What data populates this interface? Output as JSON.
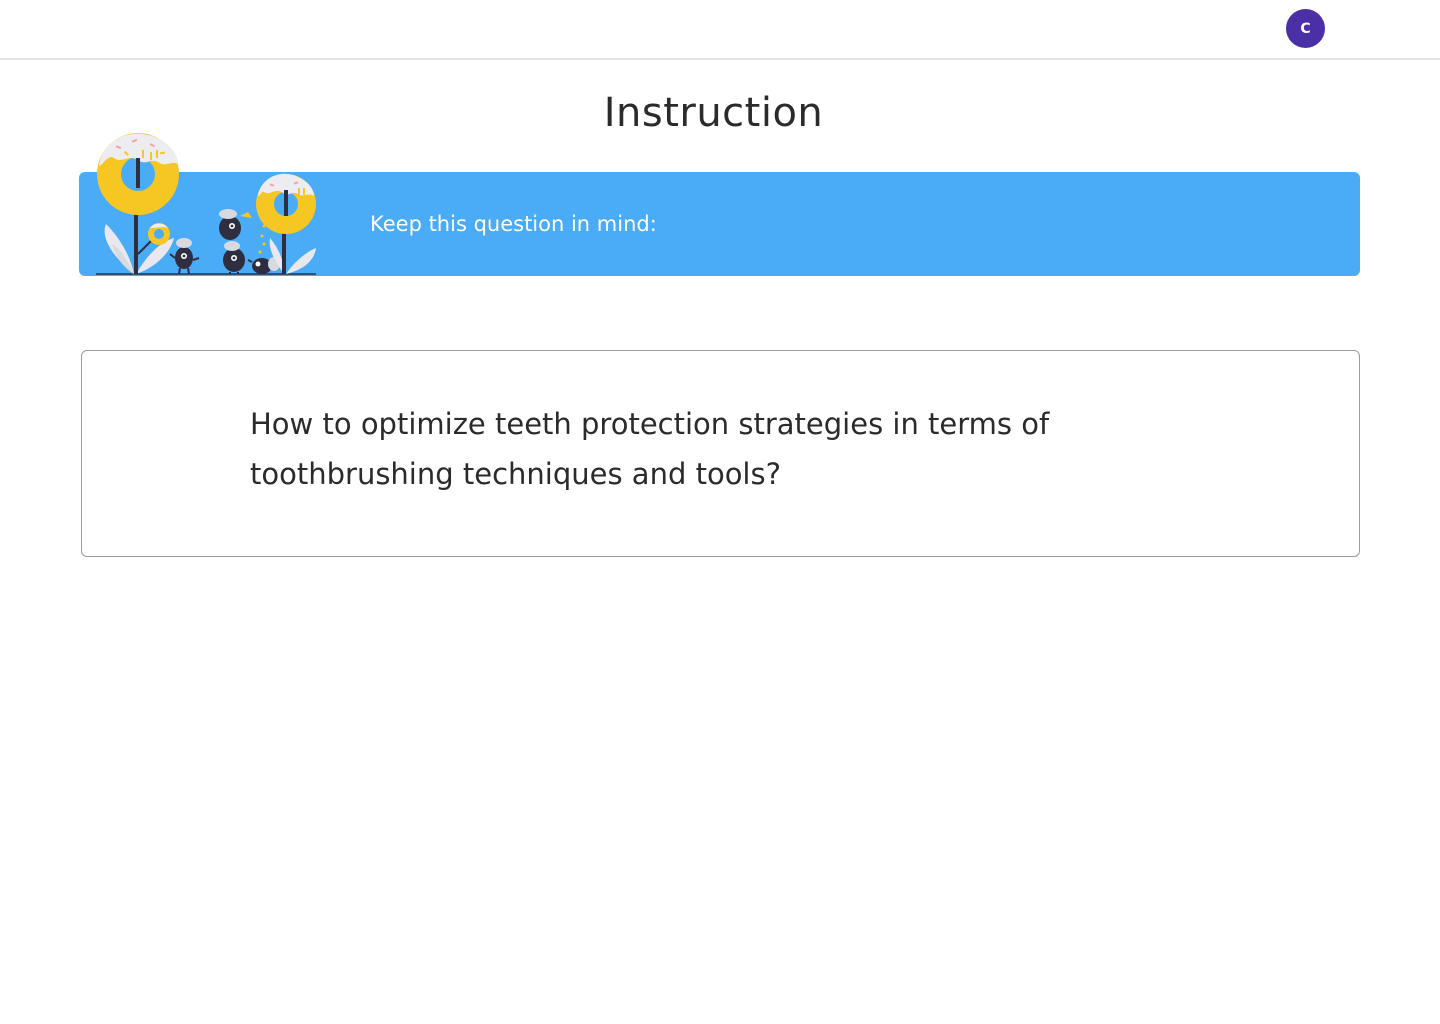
{
  "header": {
    "avatar_initial": "C",
    "avatar_color": "#4a2fa6"
  },
  "main": {
    "title": "Instruction",
    "banner": {
      "text": "Keep this question in mind:",
      "color": "#4aabf7",
      "illustration": "donut-flowers-and-creatures-illustration"
    },
    "question": {
      "text": "How to optimize teeth protection strategies in terms of toothbrushing techniques and tools?"
    }
  }
}
